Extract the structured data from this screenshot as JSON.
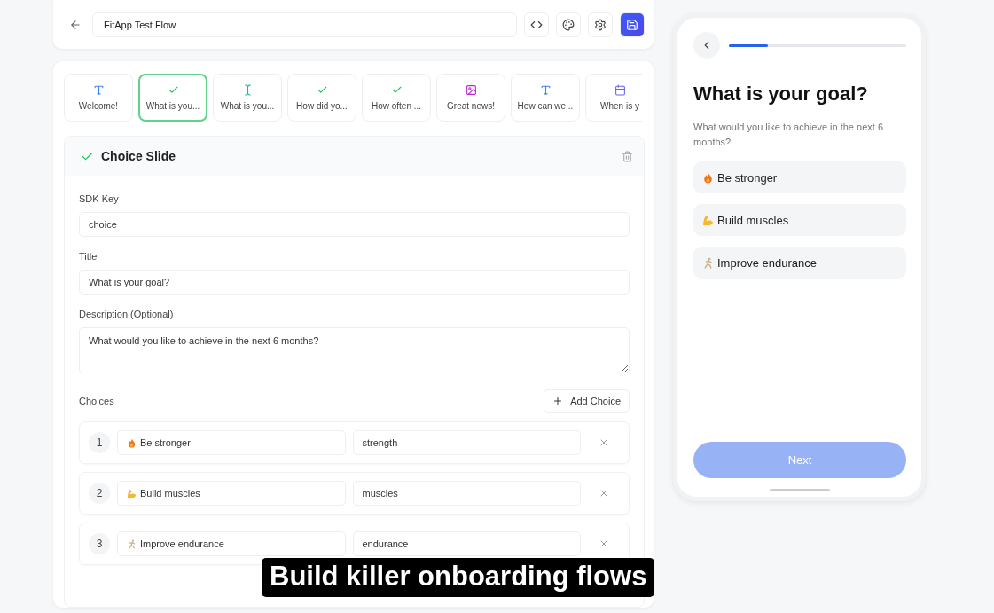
{
  "header": {
    "flow_name": "FitApp Test Flow"
  },
  "slides": [
    {
      "label": "Welcome!",
      "kind": "text",
      "selected": false
    },
    {
      "label": "What is you...",
      "kind": "check",
      "selected": true
    },
    {
      "label": "What is you...",
      "kind": "input",
      "selected": false
    },
    {
      "label": "How did yo...",
      "kind": "check",
      "selected": false
    },
    {
      "label": "How often ...",
      "kind": "check",
      "selected": false
    },
    {
      "label": "Great news!",
      "kind": "image",
      "selected": false
    },
    {
      "label": "How can we...",
      "kind": "text",
      "selected": false
    },
    {
      "label": "When is y",
      "kind": "date",
      "selected": false
    }
  ],
  "editor": {
    "title": "Choice Slide",
    "fields": [
      {
        "label": "SDK Key",
        "value": "choice",
        "kind": "input"
      },
      {
        "label": "Title",
        "value": "What is your goal?",
        "kind": "input"
      },
      {
        "label": "Description (Optional)",
        "value": "What would you like to achieve in the next 6 months?",
        "kind": "textarea"
      }
    ],
    "choices_label": "Choices",
    "add_button": "Add Choice",
    "choices": [
      {
        "number": "1",
        "label": "Be stronger",
        "value": "strength"
      },
      {
        "number": "2",
        "label": "Build muscles",
        "value": "muscles"
      },
      {
        "number": "3",
        "label": "Improve endurance",
        "value": "endurance"
      }
    ]
  },
  "preview": {
    "progress": {
      "level": 0.22
    },
    "title": "What is your goal?",
    "description": "What would you like to achieve in the next 6 months?",
    "options": [
      {
        "label": "Be stronger"
      },
      {
        "label": "Build muscles"
      },
      {
        "label": "Improve endurance"
      }
    ],
    "next_button": {
      "label": "Next",
      "disabled": true
    }
  },
  "caption": "Build killer onboarding flows"
}
